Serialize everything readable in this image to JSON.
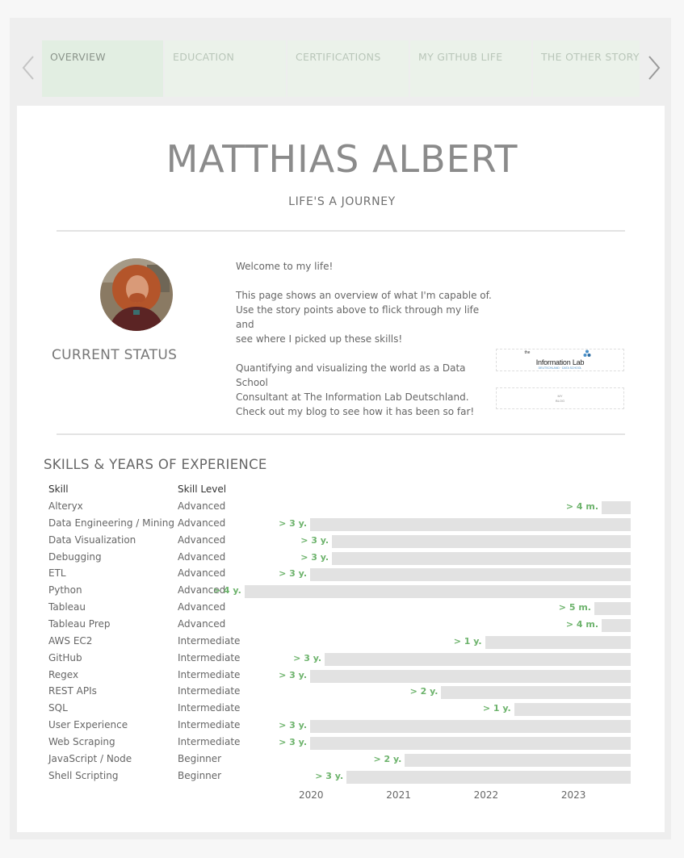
{
  "tabs": [
    {
      "label": "OVERVIEW",
      "active": true
    },
    {
      "label": "EDUCATION",
      "active": false
    },
    {
      "label": "CERTIFICATIONS",
      "active": false
    },
    {
      "label": "MY GITHUB LIFE",
      "active": false
    },
    {
      "label": "THE OTHER STORY",
      "active": false
    }
  ],
  "header": {
    "name": "MATTHIAS ALBERT",
    "tagline": "LIFE'S A JOURNEY"
  },
  "profile": {
    "status_label": "CURRENT STATUS",
    "welcome": "Welcome to my life!",
    "intro_1": "This page shows an overview of what I'm capable of.",
    "intro_2": "Use the story points above to flick through my life and",
    "intro_3": "see where I picked up these skills!",
    "status_1": "Quantifying and visualizing the world as a Data School",
    "status_2": "Consultant at The Information Lab Deutschland.",
    "status_3": "Check out my blog to see how it has been so far!"
  },
  "logos": {
    "infolab_small": "the",
    "infolab_name": "Information Lab",
    "infolab_sub": "DEUTSCHLAND · DATA SCHOOL",
    "blog_line1": "MY",
    "blog_line2": "BLOG",
    "accent": "#4a90c8"
  },
  "skills": {
    "title": "SKILLS & YEARS OF EXPERIENCE",
    "col_skill": "Skill",
    "col_level": "Skill Level",
    "bar_color": "#e2e2e2",
    "label_color": "#6db36c"
  },
  "chart_data": {
    "type": "bar",
    "orientation": "horizontal",
    "axis_ticks": [
      "2020",
      "2021",
      "2022",
      "2023"
    ],
    "axis_end": "2023-09",
    "rows": [
      {
        "skill": "Alteryx",
        "level": "Advanced",
        "start": "2023-05",
        "label": "> 4 m."
      },
      {
        "skill": "Data Engineering / Mining",
        "level": "Advanced",
        "start": "2020-01",
        "label": "> 3 y."
      },
      {
        "skill": "Data Visualization",
        "level": "Advanced",
        "start": "2020-04",
        "label": "> 3 y."
      },
      {
        "skill": "Debugging",
        "level": "Advanced",
        "start": "2020-04",
        "label": "> 3 y."
      },
      {
        "skill": "ETL",
        "level": "Advanced",
        "start": "2020-01",
        "label": "> 3 y."
      },
      {
        "skill": "Python",
        "level": "Advanced",
        "start": "2019-04",
        "label": "> 4 y."
      },
      {
        "skill": "Tableau",
        "level": "Advanced",
        "start": "2023-04",
        "label": "> 5 m."
      },
      {
        "skill": "Tableau Prep",
        "level": "Advanced",
        "start": "2023-05",
        "label": "> 4 m."
      },
      {
        "skill": "AWS EC2",
        "level": "Intermediate",
        "start": "2022-01",
        "label": "> 1 y."
      },
      {
        "skill": "GitHub",
        "level": "Intermediate",
        "start": "2020-03",
        "label": "> 3 y."
      },
      {
        "skill": "Regex",
        "level": "Intermediate",
        "start": "2020-01",
        "label": "> 3 y."
      },
      {
        "skill": "REST APIs",
        "level": "Intermediate",
        "start": "2021-07",
        "label": "> 2 y."
      },
      {
        "skill": "SQL",
        "level": "Intermediate",
        "start": "2022-05",
        "label": "> 1 y."
      },
      {
        "skill": "User Experience",
        "level": "Intermediate",
        "start": "2020-01",
        "label": "> 3 y."
      },
      {
        "skill": "Web Scraping",
        "level": "Intermediate",
        "start": "2020-01",
        "label": "> 3 y."
      },
      {
        "skill": "JavaScript / Node",
        "level": "Beginner",
        "start": "2021-02",
        "label": "> 2 y."
      },
      {
        "skill": "Shell Scripting",
        "level": "Beginner",
        "start": "2020-06",
        "label": "> 3 y."
      }
    ]
  }
}
